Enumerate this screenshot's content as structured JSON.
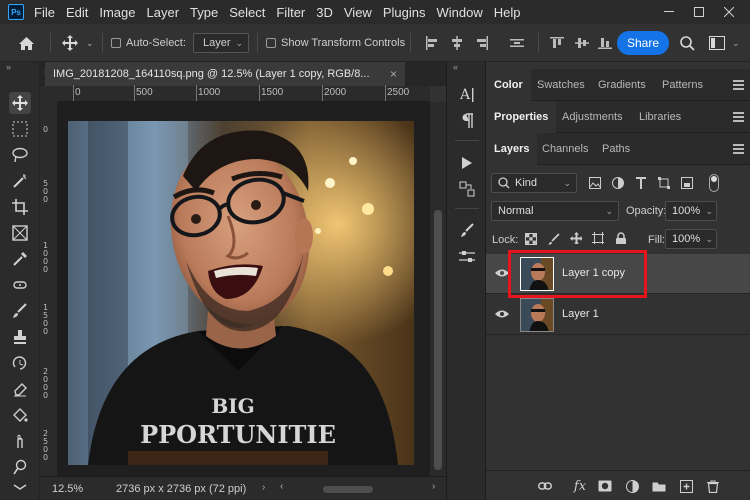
{
  "app": {
    "logo": "Ps"
  },
  "menu": [
    "File",
    "Edit",
    "Image",
    "Layer",
    "Type",
    "Select",
    "Filter",
    "3D",
    "View",
    "Plugins",
    "Window",
    "Help"
  ],
  "options": {
    "auto_select_label": "Auto-Select:",
    "layer_dropdown": "Layer",
    "show_transform_label": "Show Transform Controls",
    "share_label": "Share"
  },
  "document": {
    "tab_title": "IMG_20181208_164110sq.png @ 12.5% (Layer 1 copy, RGB/8...",
    "close_glyph": "×",
    "ruler_labels": [
      "0",
      "500",
      "1000",
      "1500",
      "2000",
      "2500"
    ],
    "zoom": "12.5%",
    "doc_size": "2736 px x 2736 px (72 ppi)"
  },
  "photo": {
    "shirt_text_1": "BIG",
    "shirt_text_2": "PPORTUNITIE"
  },
  "panels": {
    "group1_tabs": [
      "Color",
      "Swatches",
      "Gradients",
      "Patterns"
    ],
    "group2_tabs": [
      "Properties",
      "Adjustments",
      "Libraries"
    ],
    "group3_tabs": [
      "Layers",
      "Channels",
      "Paths"
    ],
    "filter_kind": "Kind",
    "blend_mode": "Normal",
    "opacity_label": "Opacity:",
    "opacity_value": "100%",
    "lock_label": "Lock:",
    "fill_label": "Fill:",
    "fill_value": "100%",
    "layers": [
      {
        "name": "Layer 1 copy",
        "selected": true
      },
      {
        "name": "Layer 1",
        "selected": false
      }
    ],
    "fx_label": "fx"
  },
  "colors": {
    "accent": "#1473e6",
    "highlight": "#e8141c"
  }
}
